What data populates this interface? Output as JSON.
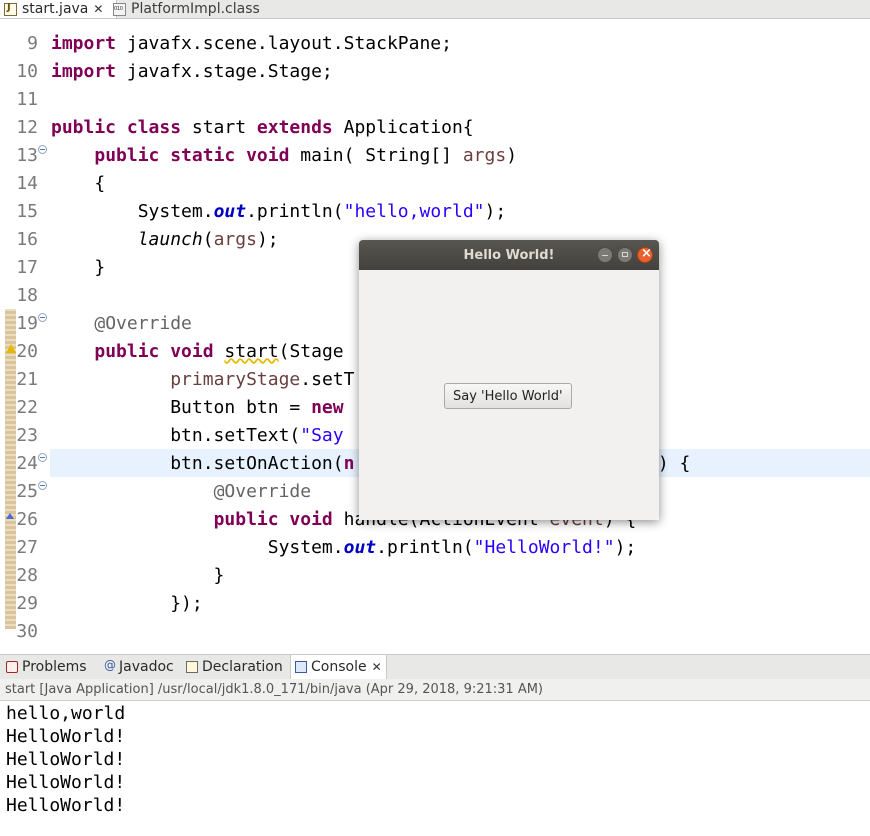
{
  "editor_tabs": [
    {
      "label": "start.java",
      "active": true,
      "icon": "java-file-icon"
    },
    {
      "label": "PlatformImpl.class",
      "active": false,
      "icon": "class-file-icon"
    }
  ],
  "code_lines": [
    {
      "num": "9",
      "text": "import javafx.scene.layout.StackPane;"
    },
    {
      "num": "10",
      "text": "import javafx.stage.Stage;"
    },
    {
      "num": "11",
      "text": ""
    },
    {
      "num": "12",
      "text": "public class start extends Application{"
    },
    {
      "num": "13",
      "text": "    public static void main( String[] args)"
    },
    {
      "num": "14",
      "text": "    {"
    },
    {
      "num": "15",
      "text": "        System.out.println(\"hello,world\");"
    },
    {
      "num": "16",
      "text": "        launch(args);"
    },
    {
      "num": "17",
      "text": "    }"
    },
    {
      "num": "18",
      "text": ""
    },
    {
      "num": "19",
      "text": "    @Override"
    },
    {
      "num": "20",
      "text": "    public void start(Stage"
    },
    {
      "num": "21",
      "text": "           primaryStage.setT"
    },
    {
      "num": "22",
      "text": "           Button btn = new"
    },
    {
      "num": "23",
      "text": "           btn.setText(\"Say"
    },
    {
      "num": "24",
      "text": "           btn.setOnAction(n                          >() {"
    },
    {
      "num": "25",
      "text": "               @Override"
    },
    {
      "num": "26",
      "text": "               public void handle(ActionEvent event) {"
    },
    {
      "num": "27",
      "text": "                    System.out.println(\"HelloWorld!\");"
    },
    {
      "num": "28",
      "text": "               }"
    },
    {
      "num": "29",
      "text": "           });"
    },
    {
      "num": "30",
      "text": ""
    }
  ],
  "popup": {
    "title": "Hello World!",
    "button_label": "Say 'Hello World'"
  },
  "panel_tabs": [
    {
      "label": "Problems",
      "icon": "problems-icon"
    },
    {
      "label": "Javadoc",
      "icon": "javadoc-icon"
    },
    {
      "label": "Declaration",
      "icon": "declaration-icon"
    },
    {
      "label": "Console",
      "icon": "console-icon",
      "active": true
    }
  ],
  "console": {
    "status": "start [Java Application] /usr/local/jdk1.8.0_171/bin/java (Apr 29, 2018, 9:21:31 AM)",
    "output": [
      "hello,world",
      "HelloWorld!",
      "HelloWorld!",
      "HelloWorld!",
      "HelloWorld!"
    ]
  }
}
